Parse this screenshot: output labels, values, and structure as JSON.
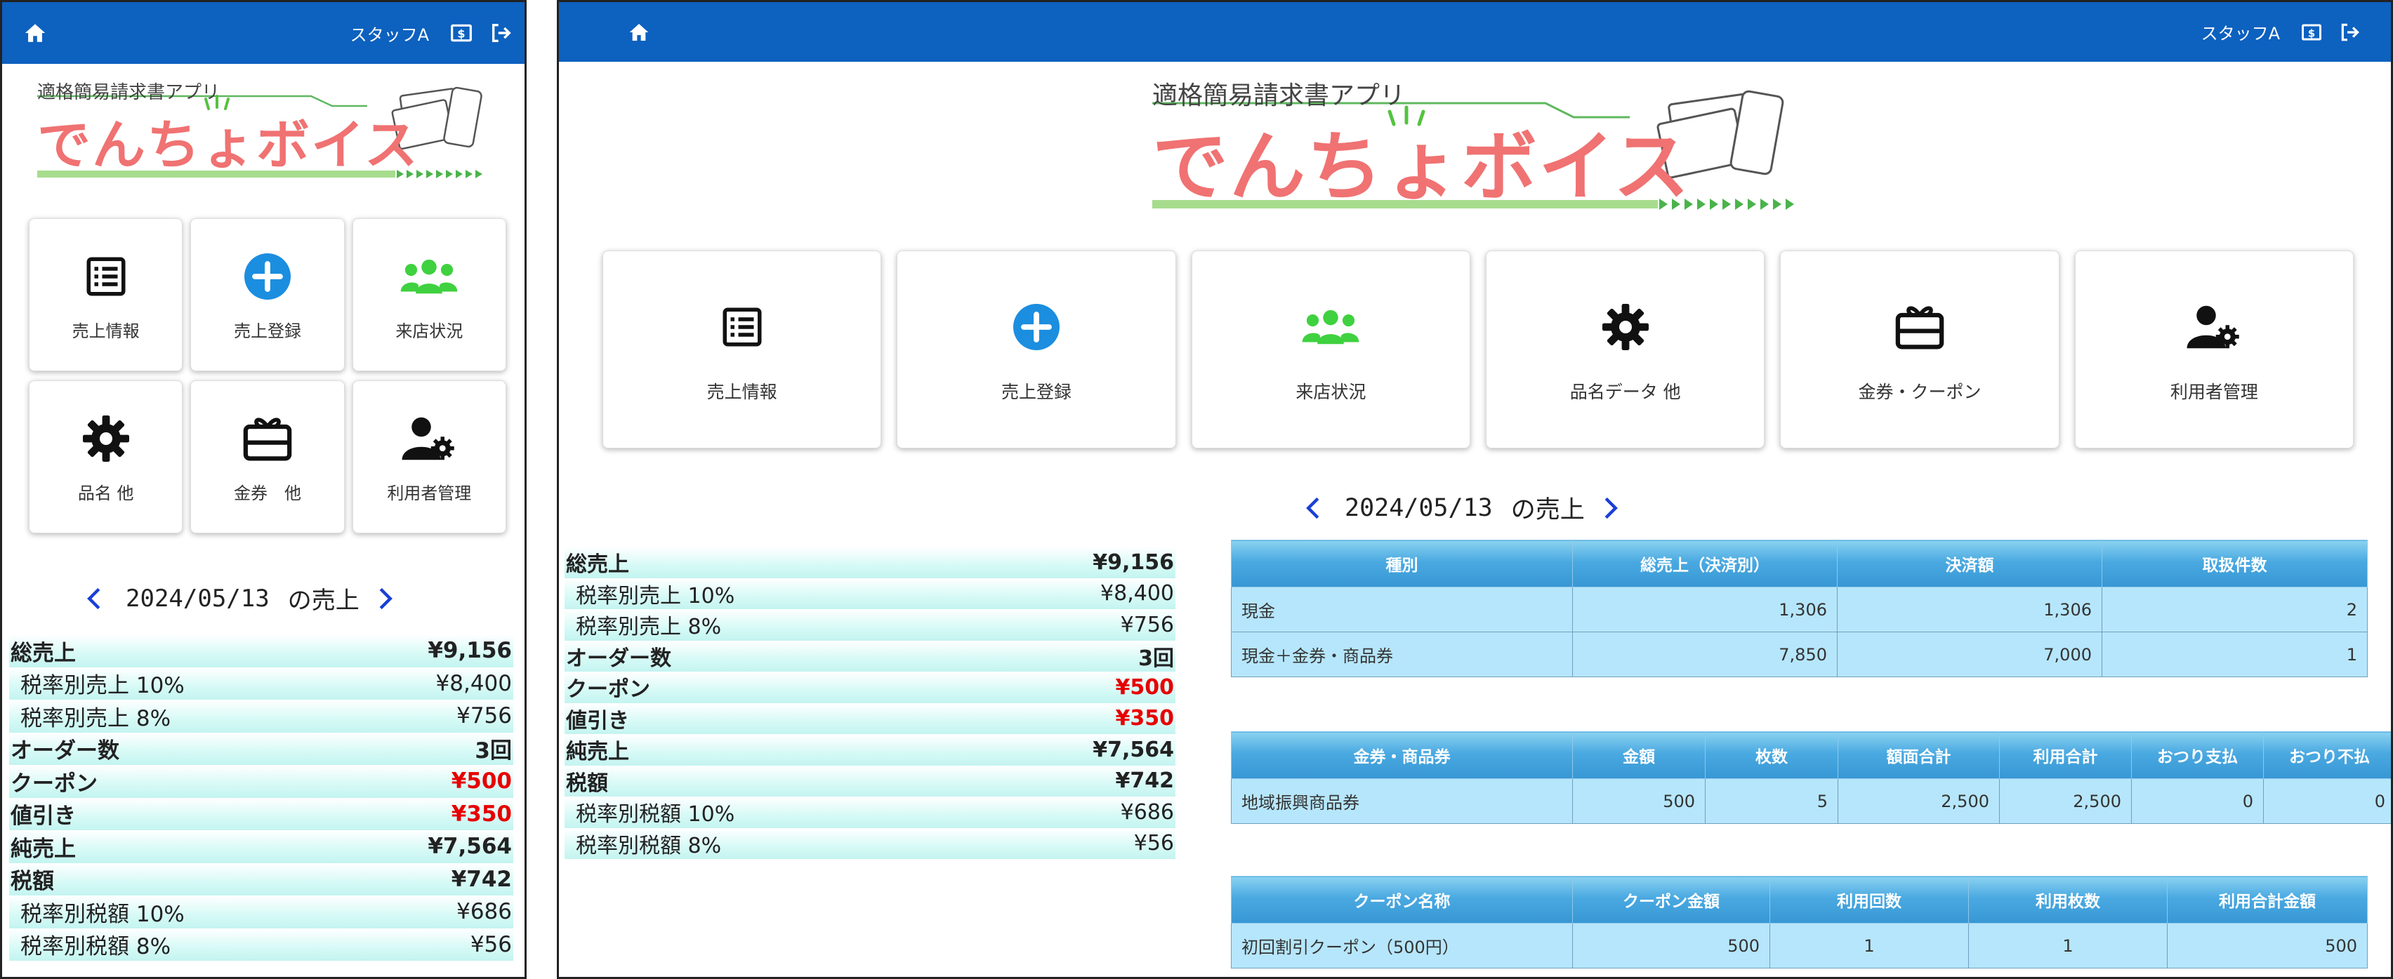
{
  "header": {
    "staff_name": "スタッフA"
  },
  "logo": {
    "subtitle": "適格簡易請求書アプリ",
    "title": "でんちょボイス"
  },
  "small_tiles": [
    {
      "label": "売上情報",
      "icon": "list-icon"
    },
    {
      "label": "売上登録",
      "icon": "plus-circle-icon"
    },
    {
      "label": "来店状況",
      "icon": "users-icon"
    },
    {
      "label": "品名 他",
      "icon": "gear-icon"
    },
    {
      "label": "金券　他",
      "icon": "gift-card-icon"
    },
    {
      "label": "利用者管理",
      "icon": "user-gear-icon"
    }
  ],
  "large_tiles": [
    {
      "label": "売上情報",
      "icon": "list-icon"
    },
    {
      "label": "売上登録",
      "icon": "plus-circle-icon"
    },
    {
      "label": "来店状況",
      "icon": "users-icon"
    },
    {
      "label": "品名データ 他",
      "icon": "gear-icon"
    },
    {
      "label": "金券・クーポン",
      "icon": "gift-card-icon"
    },
    {
      "label": "利用者管理",
      "icon": "user-gear-icon"
    }
  ],
  "date_nav": {
    "date": "2024/05/13",
    "suffix": "の売上"
  },
  "summary": [
    {
      "label": "総売上",
      "value": "¥9,156",
      "bold": true
    },
    {
      "label": "税率別売上 10%",
      "value": "¥8,400",
      "sub": true
    },
    {
      "label": "税率別売上 8%",
      "value": "¥756",
      "sub": true
    },
    {
      "label": "オーダー数",
      "value": "3回",
      "bold": true
    },
    {
      "label": "クーポン",
      "value": "¥500",
      "bold": true,
      "red": true
    },
    {
      "label": "値引き",
      "value": "¥350",
      "bold": true,
      "red": true
    },
    {
      "label": "純売上",
      "value": "¥7,564",
      "bold": true
    },
    {
      "label": "税額",
      "value": "¥742",
      "bold": true
    },
    {
      "label": "税率別税額 10%",
      "value": "¥686",
      "sub": true
    },
    {
      "label": "税率別税額 8%",
      "value": "¥56",
      "sub": true
    }
  ],
  "payment_table": {
    "headers": [
      "種別",
      "総売上（決済別）",
      "決済額",
      "取扱件数"
    ],
    "rows": [
      [
        "現金",
        "1,306",
        "1,306",
        "2"
      ],
      [
        "現金＋金券・商品券",
        "7,850",
        "7,000",
        "1"
      ]
    ]
  },
  "voucher_table": {
    "headers": [
      "金券・商品券",
      "金額",
      "枚数",
      "額面合計",
      "利用合計",
      "おつり支払",
      "おつり不払"
    ],
    "rows": [
      [
        "地域振興商品券",
        "500",
        "5",
        "2,500",
        "2,500",
        "0",
        "0"
      ]
    ]
  },
  "coupon_table": {
    "headers": [
      "クーポン名称",
      "クーポン金額",
      "利用回数",
      "利用枚数",
      "利用合計金額"
    ],
    "rows": [
      [
        "初回割引クーポン（500円）",
        "500",
        "1",
        "1",
        "500"
      ]
    ]
  },
  "colors": {
    "topbar": "#0d61bf",
    "logo_text": "#f07272",
    "plus": "#1b8ee0",
    "users": "#3fd13f",
    "negative": "#e60000",
    "table_header": "#4aa9e1",
    "table_cell": "#b6e6fb"
  }
}
